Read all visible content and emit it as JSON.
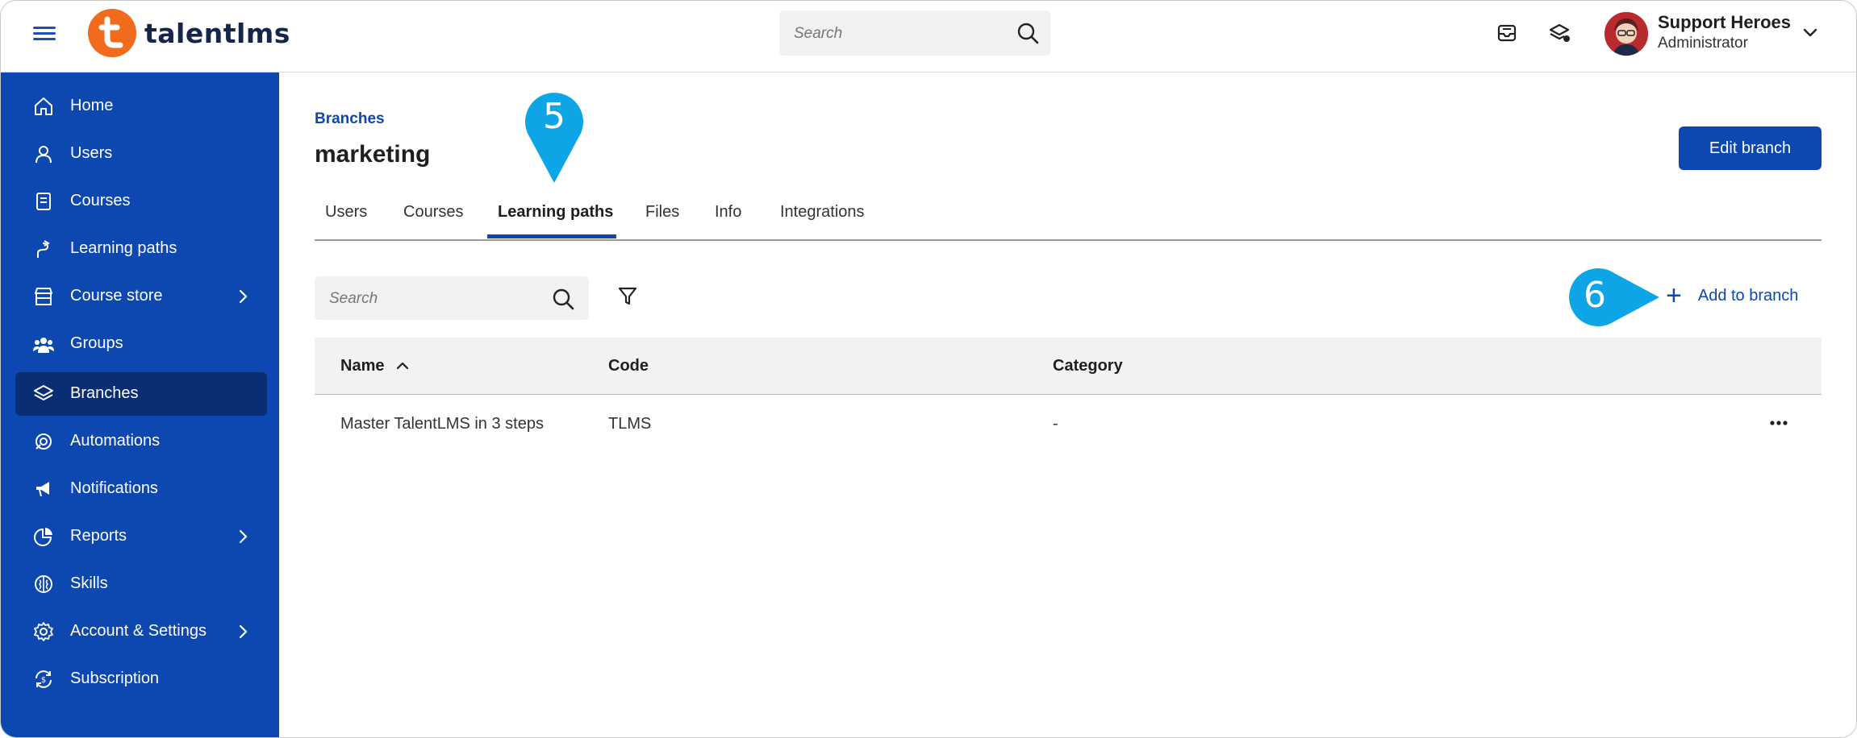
{
  "brand": {
    "name": "talentlms",
    "accent": "#f26a1b",
    "primary": "#0d47b0",
    "sidebar_active": "#0a2e74"
  },
  "topbar": {
    "search_placeholder": "Search",
    "icons": [
      "hamburger-icon",
      "search-icon",
      "inbox-icon",
      "layers-icon",
      "chevron-down-icon"
    ],
    "user": {
      "name": "Support Heroes",
      "role": "Administrator"
    }
  },
  "sidebar": {
    "items": [
      {
        "label": "Home",
        "icon": "home-icon"
      },
      {
        "label": "Users",
        "icon": "user-icon"
      },
      {
        "label": "Courses",
        "icon": "book-icon"
      },
      {
        "label": "Learning paths",
        "icon": "path-icon"
      },
      {
        "label": "Course store",
        "icon": "store-icon",
        "has_submenu": true
      },
      {
        "label": "Groups",
        "icon": "groups-icon"
      },
      {
        "label": "Branches",
        "icon": "layers-icon",
        "active": true
      },
      {
        "label": "Automations",
        "icon": "automation-icon"
      },
      {
        "label": "Notifications",
        "icon": "megaphone-icon"
      },
      {
        "label": "Reports",
        "icon": "pie-chart-icon",
        "has_submenu": true
      },
      {
        "label": "Skills",
        "icon": "brain-icon"
      },
      {
        "label": "Account & Settings",
        "icon": "gear-icon",
        "has_submenu": true
      },
      {
        "label": "Subscription",
        "icon": "subscription-icon"
      }
    ]
  },
  "main": {
    "breadcrumb": "Branches",
    "title": "marketing",
    "edit_button": "Edit branch",
    "tabs": [
      {
        "label": "Users"
      },
      {
        "label": "Courses"
      },
      {
        "label": "Learning paths",
        "active": true
      },
      {
        "label": "Files"
      },
      {
        "label": "Info"
      },
      {
        "label": "Integrations"
      }
    ],
    "search_placeholder": "Search",
    "add_button": "Add to branch",
    "table": {
      "columns": [
        "Name",
        "Code",
        "Category"
      ],
      "sort": {
        "column": "Name",
        "direction": "ascending"
      },
      "rows": [
        {
          "name": "Master TalentLMS in 3 steps",
          "code": "TLMS",
          "category": "-"
        }
      ]
    }
  },
  "callouts": [
    {
      "number": "5",
      "color": "#0ea5e6"
    },
    {
      "number": "6",
      "color": "#0ea5e6"
    }
  ]
}
